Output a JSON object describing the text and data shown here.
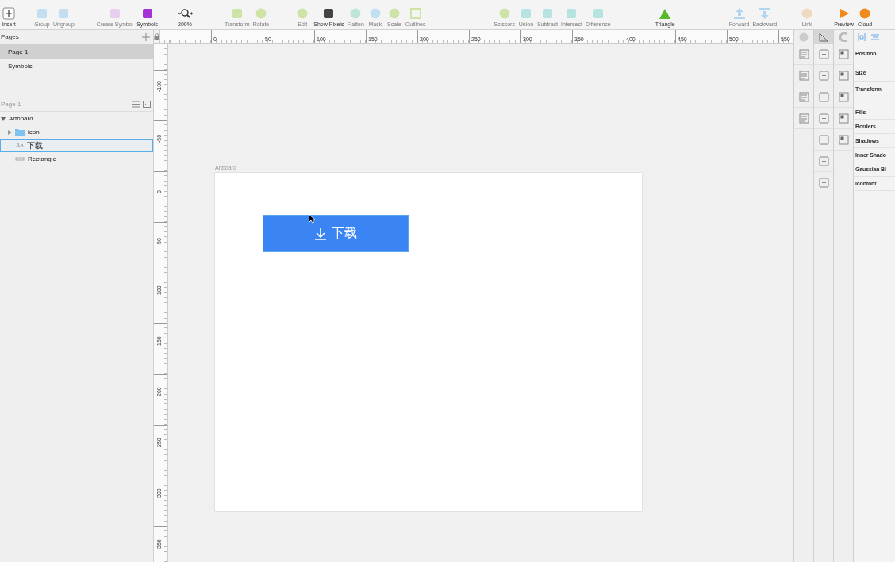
{
  "toolbar": [
    {
      "items": [
        {
          "label": "Insert",
          "disabled": false
        }
      ]
    },
    {
      "items": [
        {
          "label": "Group",
          "disabled": true
        },
        {
          "label": "Ungroup",
          "disabled": true
        }
      ]
    },
    {
      "items": [
        {
          "label": "Create Symbol",
          "disabled": true
        },
        {
          "label": "Symbols",
          "disabled": false
        }
      ]
    },
    {
      "items": [
        {
          "label": "200%",
          "disabled": false
        }
      ]
    },
    {
      "items": [
        {
          "label": "Transform",
          "disabled": true
        },
        {
          "label": "Rotate",
          "disabled": true
        }
      ]
    },
    {
      "items": [
        {
          "label": "Edit",
          "disabled": true
        },
        {
          "label": "Show Pixels",
          "disabled": false
        },
        {
          "label": "Flatten",
          "disabled": true
        },
        {
          "label": "Mask",
          "disabled": true
        },
        {
          "label": "Scale",
          "disabled": true
        },
        {
          "label": "Outlines",
          "disabled": true
        }
      ]
    },
    {
      "items": [
        {
          "label": "Scissors",
          "disabled": true
        },
        {
          "label": "Union",
          "disabled": true
        },
        {
          "label": "Subtract",
          "disabled": true
        },
        {
          "label": "Intersect",
          "disabled": true
        },
        {
          "label": "Difference",
          "disabled": true
        }
      ]
    },
    {
      "items": [
        {
          "label": "Triangle",
          "disabled": false
        }
      ]
    },
    {
      "items": [
        {
          "label": "Forward",
          "disabled": true
        },
        {
          "label": "Backward",
          "disabled": true
        }
      ]
    },
    {
      "items": [
        {
          "label": "Link",
          "disabled": true
        }
      ]
    },
    {
      "items": [
        {
          "label": "Preview",
          "disabled": false
        },
        {
          "label": "Cloud",
          "disabled": false
        }
      ]
    }
  ],
  "pages": {
    "title": "Pages",
    "items": [
      {
        "label": "Page 1",
        "selected": true
      },
      {
        "label": "Symbols",
        "selected": false
      }
    ]
  },
  "layers": {
    "title": "Page 1",
    "items": [
      {
        "label": "Artboard",
        "kind": "artboard",
        "expanded": true,
        "selected": false,
        "children": [
          {
            "label": "icon",
            "kind": "group",
            "expanded": false,
            "selected": false
          },
          {
            "label": "下载",
            "kind": "text",
            "badge": "Aa",
            "selected": true
          },
          {
            "label": "Rectangle",
            "kind": "shape",
            "selected": false
          }
        ]
      }
    ]
  },
  "rulers": {
    "horizontal": [
      "0",
      "50",
      "100",
      "150",
      "200",
      "250",
      "300",
      "350",
      "400",
      "450",
      "500",
      "550"
    ],
    "vertical": [
      "-100",
      "-50",
      "0",
      "50",
      "100",
      "150",
      "200",
      "250",
      "300",
      "350"
    ]
  },
  "artboard": {
    "title": "Artboard",
    "button": {
      "label": "下载"
    }
  },
  "inspector": {
    "sections": [
      "Position",
      "Size",
      "Transform",
      "Fills",
      "Borders",
      "Shadows",
      "Inner Shado",
      "Gaussian Bl",
      "iconfont"
    ]
  }
}
